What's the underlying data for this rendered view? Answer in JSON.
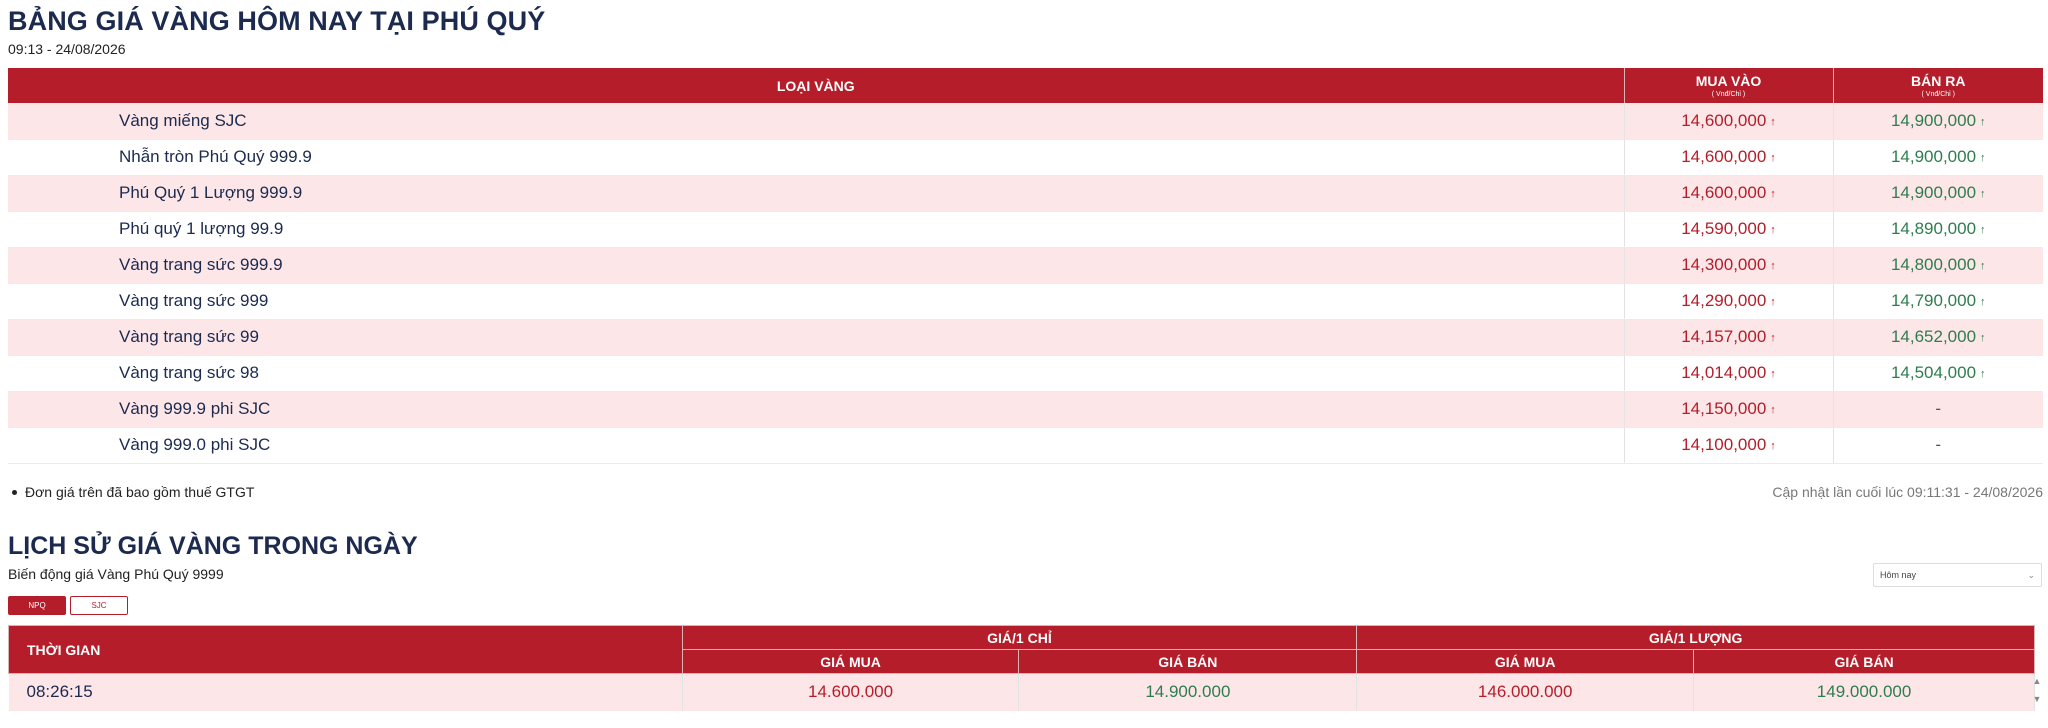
{
  "header": {
    "title": "BẢNG GIÁ VÀNG HÔM NAY TẠI PHÚ QUÝ",
    "datetime": "09:13 - 24/08/2026"
  },
  "price_table": {
    "col_type": "LOẠI VÀNG",
    "col_buy": "MUA VÀO",
    "col_sell": "BÁN RA",
    "unit": "( Vnđ/Chỉ )",
    "arrow": "↑",
    "rows": [
      {
        "name": "Vàng miếng SJC",
        "buy": "14,600,000",
        "sell": "14,900,000"
      },
      {
        "name": "Nhẫn tròn Phú Quý 999.9",
        "buy": "14,600,000",
        "sell": "14,900,000"
      },
      {
        "name": "Phú Quý 1 Lượng 999.9",
        "buy": "14,600,000",
        "sell": "14,900,000"
      },
      {
        "name": "Phú quý 1 lượng 99.9",
        "buy": "14,590,000",
        "sell": "14,890,000"
      },
      {
        "name": "Vàng trang sức 999.9",
        "buy": "14,300,000",
        "sell": "14,800,000"
      },
      {
        "name": "Vàng trang sức 999",
        "buy": "14,290,000",
        "sell": "14,790,000"
      },
      {
        "name": "Vàng trang sức 99",
        "buy": "14,157,000",
        "sell": "14,652,000"
      },
      {
        "name": "Vàng trang sức 98",
        "buy": "14,014,000",
        "sell": "14,504,000"
      },
      {
        "name": "Vàng 999.9 phi SJC",
        "buy": "14,150,000",
        "sell": "-"
      },
      {
        "name": "Vàng 999.0 phi SJC",
        "buy": "14,100,000",
        "sell": "-"
      }
    ]
  },
  "note": "Đơn giá trên đã bao gồm thuế GTGT",
  "updated": "Cập nhật lần cuối lúc 09:11:31 - 24/08/2026",
  "history": {
    "title": "LỊCH SỬ GIÁ VÀNG TRONG NGÀY",
    "subtitle": "Biến động giá Vàng Phú Quý 9999",
    "select_value": "Hôm nay",
    "tabs": [
      "NPQ",
      "SJC"
    ],
    "col_time": "THỜI GIAN",
    "group_chi": "GIÁ/1 CHỈ",
    "group_luong": "GIÁ/1 LƯỢNG",
    "col_mua": "GIÁ MUA",
    "col_ban": "GIÁ BÁN",
    "rows": [
      {
        "time": "08:26:15",
        "chi_mua": "14.600.000",
        "chi_ban": "14.900.000",
        "luong_mua": "146.000.000",
        "luong_ban": "149.000.000"
      }
    ]
  },
  "colors": {
    "header_red": "#b51d2a",
    "row_pink": "#fde6e8",
    "buy_red": "#b51d2a",
    "sell_green": "#2e7d4f",
    "title_navy": "#1b2a4e"
  },
  "icons": {
    "up_arrow": "up-arrow-icon",
    "select_chevron": "chevron-down-icon",
    "scroll_up": "scroll-up-icon",
    "scroll_down": "scroll-down-icon"
  }
}
